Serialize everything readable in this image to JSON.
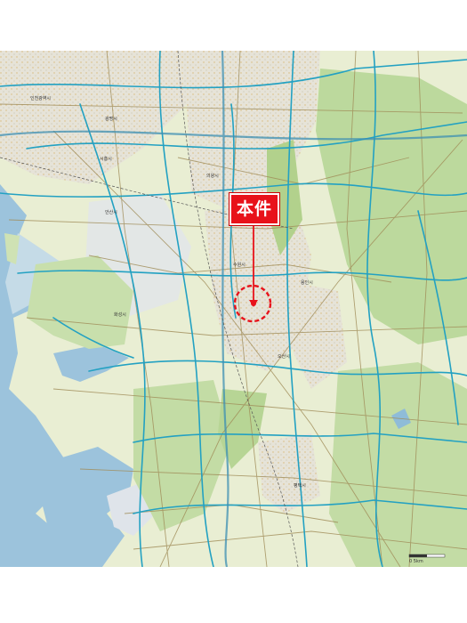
{
  "callout": {
    "label": "本件"
  },
  "map": {
    "colors": {
      "sea": "#9cc3dc",
      "tidal": "#c6dbe8",
      "land": "#e7edd0",
      "urban": "#dde3e4",
      "forest": "#b9d79a",
      "highway": "#2aa5c4",
      "road": "#9a8a5a",
      "marker": "#e8121a"
    },
    "place_labels": [
      "인천광역시",
      "시흥시",
      "안산시",
      "화성시",
      "수원시",
      "용인시",
      "평택시",
      "오산시",
      "의왕시",
      "광명시"
    ],
    "scale_label": "0     5km"
  }
}
